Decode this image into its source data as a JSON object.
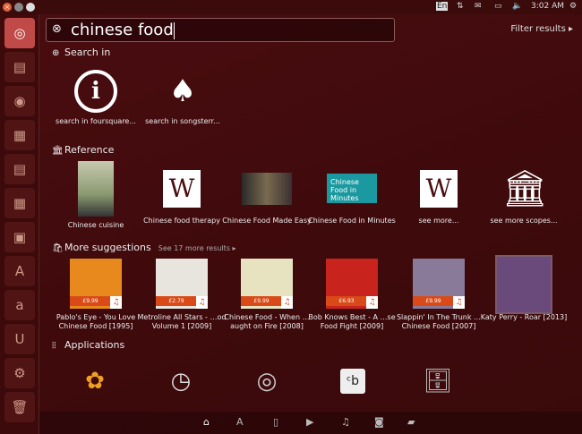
{
  "panel": {
    "keyboard": "En",
    "time": "3:02 AM"
  },
  "search": {
    "query": "chinese food",
    "filter_label": "Filter results ▸"
  },
  "sections": {
    "search_in": {
      "title": "Search in",
      "items": [
        "search in foursquare...",
        "search in songsterr..."
      ]
    },
    "reference": {
      "title": "Reference",
      "items": [
        "Chinese cuisine",
        "Chinese food therapy",
        "Chinese Food Made Easy",
        "Chinese Food in Minutes",
        "see more...",
        "see more scopes..."
      ],
      "thumb_text": "Chinese Food in Minutes",
      "wiki_glyph": "W"
    },
    "suggestions": {
      "title": "More suggestions",
      "more": "See 17 more results ▸",
      "items": [
        {
          "label": "Pablo's Eye - You Love Chinese Food [1995]",
          "price": "£9.99",
          "color": "#e8891e"
        },
        {
          "label": "Metroline All Stars - …od Volume 1 [2009]",
          "price": "£2.79",
          "color": "#e8e4de"
        },
        {
          "label": "Chinese Food - When …aught on Fire [2008]",
          "price": "£9.99",
          "color": "#e7e3c0"
        },
        {
          "label": "Bob Knows Best - A …se Food Fight [2009]",
          "price": "£6.93",
          "color": "#c8231c"
        },
        {
          "label": "Slappin' In The Trunk …Chinese Food [2007]",
          "price": "£9.99",
          "color": "#8a7a9a"
        },
        {
          "label": "Katy Perry - Roar [2013]",
          "price": "",
          "color": "#6a4a7a"
        }
      ]
    },
    "applications": {
      "title": "Applications"
    }
  },
  "bottom_icons": [
    "home-icon",
    "applications-icon",
    "files-icon",
    "video-icon",
    "music-icon",
    "photos-icon",
    "social-icon"
  ]
}
